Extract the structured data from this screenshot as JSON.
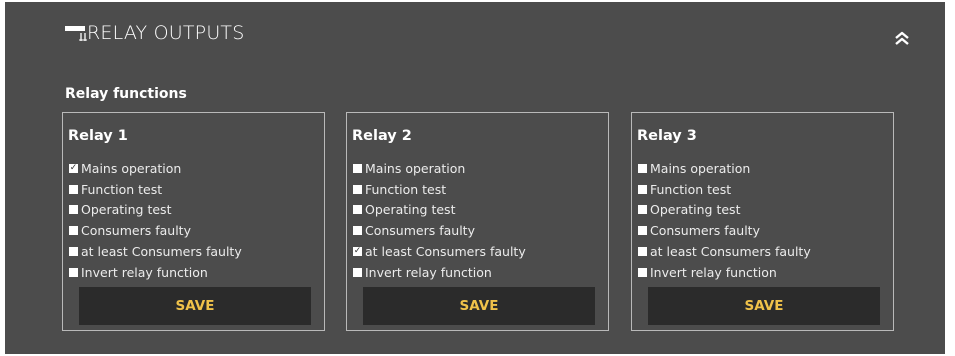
{
  "header": {
    "title": "RELAY OUTPUTS"
  },
  "section": {
    "title": "Relay functions"
  },
  "relays": [
    {
      "title": "Relay 1",
      "options": [
        {
          "label": "Mains operation",
          "checked": true
        },
        {
          "label": "Function test",
          "checked": false
        },
        {
          "label": "Operating test",
          "checked": false
        },
        {
          "label": "Consumers faulty",
          "checked": false
        },
        {
          "label": "at least Consumers faulty",
          "checked": false
        },
        {
          "label": "Invert relay function",
          "checked": false
        }
      ],
      "save_label": "SAVE"
    },
    {
      "title": "Relay 2",
      "options": [
        {
          "label": "Mains operation",
          "checked": false
        },
        {
          "label": "Function test",
          "checked": false
        },
        {
          "label": "Operating test",
          "checked": false
        },
        {
          "label": "Consumers faulty",
          "checked": false
        },
        {
          "label": "at least Consumers faulty",
          "checked": true
        },
        {
          "label": "Invert relay function",
          "checked": false
        }
      ],
      "save_label": "SAVE"
    },
    {
      "title": "Relay 3",
      "options": [
        {
          "label": "Mains operation",
          "checked": false
        },
        {
          "label": "Function test",
          "checked": false
        },
        {
          "label": "Operating test",
          "checked": false
        },
        {
          "label": "Consumers faulty",
          "checked": false
        },
        {
          "label": "at least Consumers faulty",
          "checked": false
        },
        {
          "label": "Invert relay function",
          "checked": false
        }
      ],
      "save_label": "SAVE"
    }
  ],
  "colors": {
    "panel": "#4c4c4c",
    "button": "#2b2b2b",
    "accent": "#f0c24a"
  },
  "icons": {
    "header": "relay-output-icon",
    "collapse": "double-chevron-up-icon",
    "check": "checkmark-icon"
  }
}
